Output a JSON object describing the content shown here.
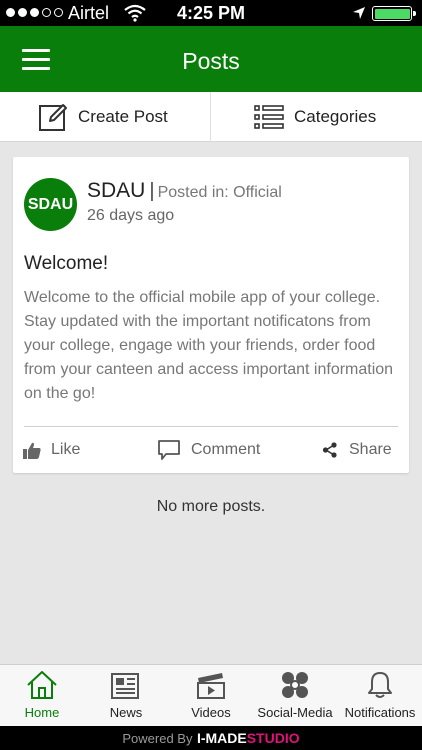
{
  "status_bar": {
    "carrier": "Airtel",
    "time": "4:25 PM",
    "signal_bars_filled": 3,
    "signal_bars_total": 5,
    "battery_level": 1.0,
    "icons": [
      "wifi-icon",
      "location-arrow-icon",
      "battery-icon"
    ]
  },
  "header": {
    "title": "Posts",
    "menu_icon": "hamburger-menu-icon"
  },
  "toolbar": {
    "create_post_label": "Create Post",
    "create_post_icon": "edit-icon",
    "categories_label": "Categories",
    "categories_icon": "list-icon"
  },
  "post": {
    "avatar_text": "SDAU",
    "author": "SDAU",
    "separator": "|",
    "posted_in_label": "Posted in:",
    "category": "Official",
    "time_ago": "26 days ago",
    "title": "Welcome!",
    "body": "Welcome to the official mobile app of your college. Stay updated with the important notificatons from your college, engage with your friends, order food from your canteen and access important information on the go!",
    "actions": {
      "like": "Like",
      "comment": "Comment",
      "share": "Share"
    }
  },
  "feed_end_text": "No more posts.",
  "tabs": [
    {
      "label": "Home",
      "icon": "home-icon",
      "active": true
    },
    {
      "label": "News",
      "icon": "newspaper-icon",
      "active": false
    },
    {
      "label": "Videos",
      "icon": "video-clapper-icon",
      "active": false
    },
    {
      "label": "Social-Media",
      "icon": "social-network-icon",
      "active": false
    },
    {
      "label": "Notifications",
      "icon": "bell-icon",
      "active": false
    }
  ],
  "footer": {
    "powered_by": "Powered By",
    "brand_a": "I-MADE",
    "brand_b": "STUDIO"
  },
  "colors": {
    "primary": "#0a7e0a",
    "brand_accent": "#e0117a",
    "background": "#e6e6e6"
  }
}
